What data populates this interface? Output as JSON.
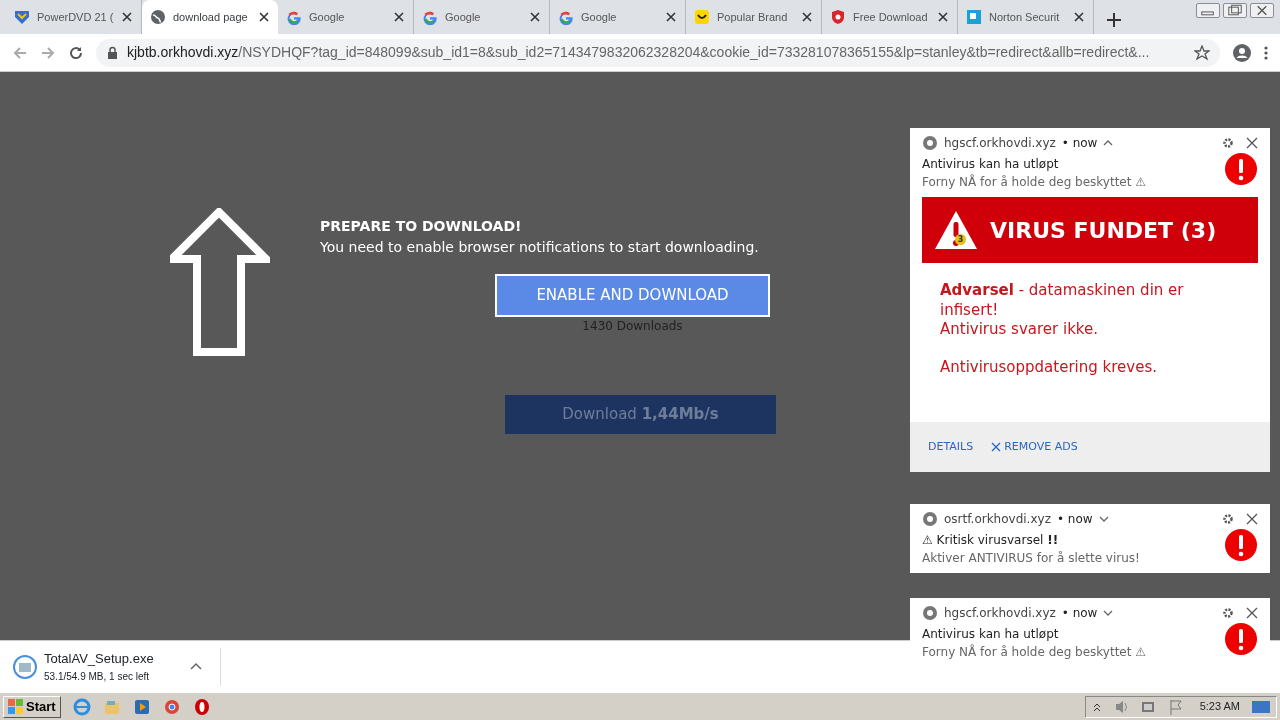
{
  "tabs": [
    {
      "label": "PowerDVD 21 (",
      "kind": "dvd",
      "selected": false
    },
    {
      "label": "download page",
      "kind": "globe",
      "selected": true
    },
    {
      "label": "Google",
      "kind": "google",
      "selected": false
    },
    {
      "label": "Google",
      "kind": "google",
      "selected": false
    },
    {
      "label": "Google",
      "kind": "google",
      "selected": false
    },
    {
      "label": "Popular Brand",
      "kind": "smile",
      "selected": false
    },
    {
      "label": "Free Download",
      "kind": "shield",
      "selected": false
    },
    {
      "label": "Norton Securit",
      "kind": "norton",
      "selected": false
    }
  ],
  "address_bar": {
    "host": "kjbtb.orkhovdi.xyz",
    "path": "/NSYDHQF?tag_id=848099&sub_id1=8&sub_id2=7143479832062328204&cookie_id=733281078365155&lp=stanley&tb=redirect&allb=redirect&..."
  },
  "page": {
    "heading": "PREPARE TO DOWNLOAD!",
    "subheading": "You need to enable browser notifications to start downloading.",
    "enable_button": "ENABLE AND DOWNLOAD",
    "downloads_count": "1430 Downloads",
    "download_button": "Download **1,44Mb/s**"
  },
  "notifications": [
    {
      "kind": "banner",
      "site": "hgscf.orkhovdi.xyz",
      "time": "• now",
      "expanded": true,
      "title": "Antivirus kan ha utløpt",
      "body": "Forny NÅ for å holde deg beskyttet ⚠",
      "banner_title": "VIRUS FUNDET (3)",
      "banner_badge": "3",
      "message": [
        "**Advarsel** - datamaskinen din er infisert!",
        "Antivirus svarer ikke.",
        "Antivirusoppdatering kreves."
      ],
      "actions": [
        "DETAILS",
        "REMOVE ADS"
      ]
    },
    {
      "kind": "plain",
      "site": "osrtf.orkhovdi.xyz",
      "time": "• now",
      "expanded": false,
      "title": "⚠ Kritisk virusvarsel **!!**",
      "body": "Aktiver ANTIVIRUS for å slette virus!"
    },
    {
      "kind": "plain",
      "site": "hgscf.orkhovdi.xyz",
      "time": "• now",
      "expanded": false,
      "title": "Antivirus kan ha utløpt",
      "body": "Forny NÅ for å holde deg beskyttet ⚠"
    }
  ],
  "download_shelf": {
    "file": "TotalAV_Setup.exe",
    "status": "53.1/54.9 MB, 1 sec left"
  },
  "taskbar": {
    "start": "Start",
    "clock": "5:23 AM"
  }
}
